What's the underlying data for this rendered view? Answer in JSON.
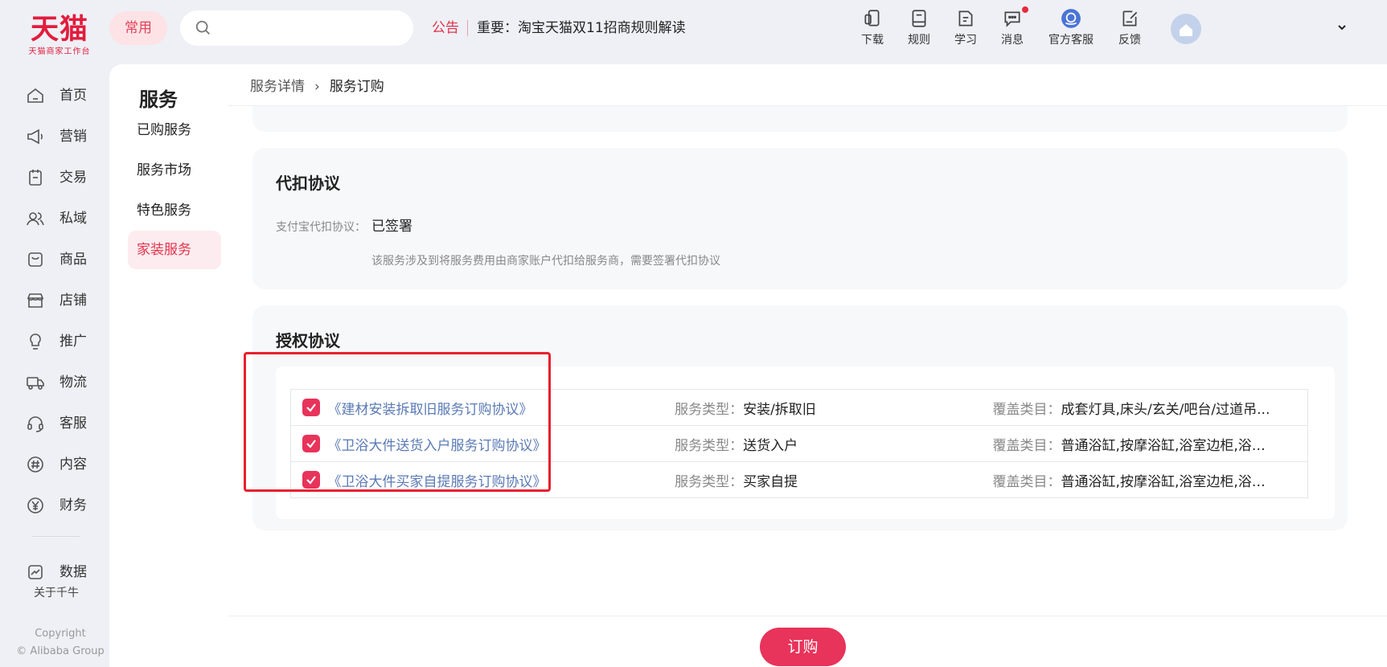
{
  "logo": {
    "main": "天猫",
    "sub": "天猫商家工作台"
  },
  "header": {
    "common_label": "常用",
    "search": {
      "placeholder": "",
      "value": ""
    },
    "notice_tag": "公告",
    "notice_text": "重要：淘宝天猫双11招商规则解读",
    "tools": [
      {
        "label": "下载",
        "icon": "download-phone-icon"
      },
      {
        "label": "规则",
        "icon": "rules-book-icon"
      },
      {
        "label": "学习",
        "icon": "learn-icon"
      },
      {
        "label": "消息",
        "icon": "message-icon",
        "has_dot": true
      },
      {
        "label": "官方客服",
        "icon": "customer-service-icon"
      },
      {
        "label": "反馈",
        "icon": "feedback-icon"
      }
    ]
  },
  "leftnav": {
    "items": [
      {
        "label": "首页",
        "icon": "home-icon"
      },
      {
        "label": "营销",
        "icon": "megaphone-icon"
      },
      {
        "label": "交易",
        "icon": "clipboard-icon"
      },
      {
        "label": "私域",
        "icon": "users-icon"
      },
      {
        "label": "商品",
        "icon": "product-bag-icon"
      },
      {
        "label": "店铺",
        "icon": "store-icon"
      },
      {
        "label": "推广",
        "icon": "lightbulb-icon"
      },
      {
        "label": "物流",
        "icon": "truck-icon"
      },
      {
        "label": "客服",
        "icon": "headset-icon"
      },
      {
        "label": "内容",
        "icon": "hash-icon"
      },
      {
        "label": "财务",
        "icon": "yen-icon"
      },
      {
        "label": "数据",
        "icon": "chart-icon"
      }
    ],
    "about": "关于千牛",
    "copyright_line1": "Copyright",
    "copyright_line2": "© Alibaba Group"
  },
  "service_menu": {
    "title": "服务",
    "items": [
      {
        "label": "已购服务",
        "active": false
      },
      {
        "label": "服务市场",
        "active": false
      },
      {
        "label": "特色服务",
        "active": false
      },
      {
        "label": "家装服务",
        "active": true
      }
    ]
  },
  "breadcrumb": {
    "parent": "服务详情",
    "separator": "›",
    "current": "服务订购"
  },
  "withholding": {
    "title": "代扣协议",
    "label": "支付宝代扣协议：",
    "value": "已签署",
    "description": "该服务涉及到将服务费用由商家账户代扣给服务商，需要签署代扣协议"
  },
  "authorization": {
    "title": "授权协议",
    "rows": [
      {
        "checked": true,
        "link": "《建材安装拆取旧服务订购协议》",
        "type_label": "服务类型：",
        "type_value": "安装/拆取旧",
        "cover_label": "覆盖类目：",
        "cover_value": "成套灯具,床头/玄关/吧台/过道吊..."
      },
      {
        "checked": true,
        "link": "《卫浴大件送货入户服务订购协议》",
        "type_label": "服务类型：",
        "type_value": "送货入户",
        "cover_label": "覆盖类目：",
        "cover_value": "普通浴缸,按摩浴缸,浴室边柜,浴室..."
      },
      {
        "checked": true,
        "link": "《卫浴大件买家自提服务订购协议》",
        "type_label": "服务类型：",
        "type_value": "买家自提",
        "cover_label": "覆盖类目：",
        "cover_value": "普通浴缸,按摩浴缸,浴室边柜,浴室..."
      }
    ]
  },
  "order_button": "订购",
  "colors": {
    "brand_red": "#e21c3d",
    "accent": "#e8335a",
    "link": "#5a7ab5",
    "highlight_box": "#e8202e"
  }
}
